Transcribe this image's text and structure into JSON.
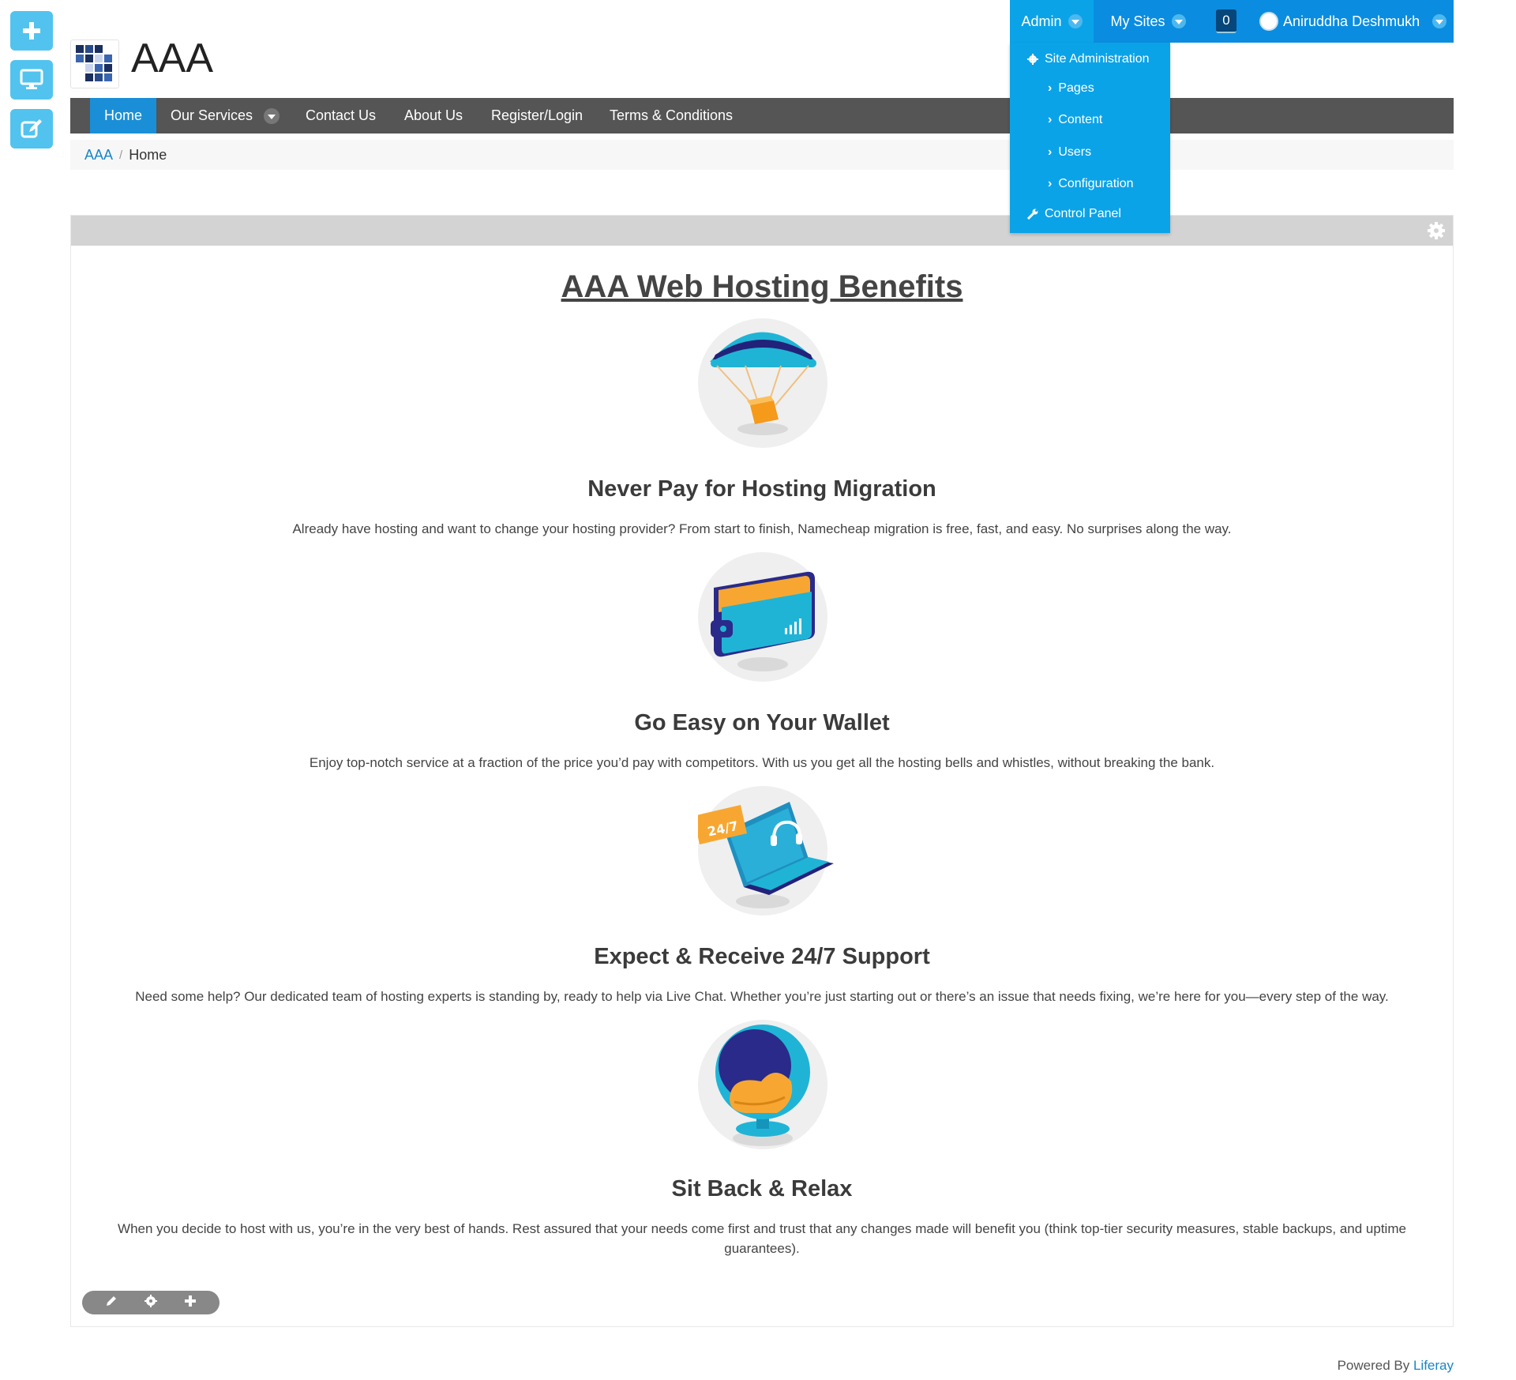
{
  "site": {
    "title": "AAA"
  },
  "dockbar": {
    "admin_label": "Admin",
    "mysites_label": "My Sites",
    "notification_count": "0",
    "user_name": "Aniruddha Deshmukh"
  },
  "admin_menu": {
    "site_admin": "Site Administration",
    "pages": "Pages",
    "content": "Content",
    "users": "Users",
    "configuration": "Configuration",
    "control_panel": "Control Panel"
  },
  "nav": {
    "home": "Home",
    "services": "Our Services",
    "contact": "Contact Us",
    "about": "About Us",
    "register": "Register/Login",
    "terms": "Terms & Conditions"
  },
  "breadcrumb": {
    "site": "AAA",
    "separator": "/",
    "current": "Home"
  },
  "content": {
    "title": "AAA Web Hosting Benefits",
    "features": [
      {
        "heading": "Never Pay for Hosting Migration",
        "text": "Already have hosting and want to change your hosting provider? From start to finish, Namecheap migration is free, fast, and easy. No surprises along the way."
      },
      {
        "heading": "Go Easy on Your Wallet",
        "text": "Enjoy top-notch service at a fraction of the price you’d pay with competitors. With us you get all the hosting bells and whistles, without breaking the bank."
      },
      {
        "heading": "Expect & Receive 24/7 Support",
        "text": "Need some help? Our dedicated team of hosting experts is standing by, ready to help via Live Chat. Whether you’re just starting out or there’s an issue that needs fixing, we’re here for you—every step of the way.",
        "badge": "24/7"
      },
      {
        "heading": "Sit Back & Relax",
        "text": "When you decide to host with us, you’re in the very best of hands. Rest assured that your needs come first and trust that any changes made will benefit you (think top-tier security measures, stable backups, and uptime guarantees)."
      }
    ]
  },
  "footer": {
    "powered_by": "Powered By",
    "brand": "Liferay"
  },
  "colors": {
    "accent": "#0ba3e8",
    "nav_bg": "#555555",
    "dock_btn": "#52c3ee"
  }
}
